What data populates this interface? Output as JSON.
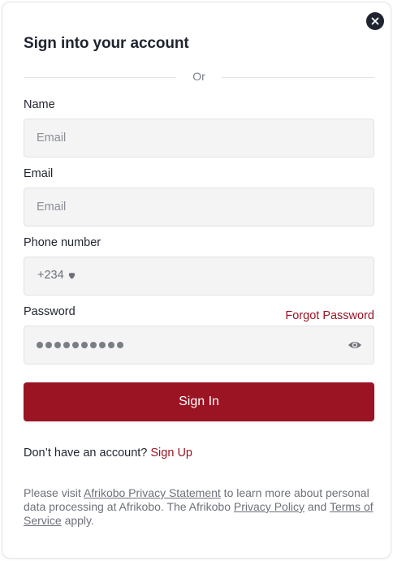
{
  "modal": {
    "title": "Sign into your account",
    "divider_text": "Or"
  },
  "form": {
    "name_label": "Name",
    "name_placeholder": "Email",
    "email_label": "Email",
    "email_placeholder": "Email",
    "phone_label": "Phone number",
    "phone_prefix": "+234",
    "password_label": "Password",
    "password_dots": "●●●●●●●●●●",
    "forgot_password": "Forgot Password",
    "submit_label": "Sign In"
  },
  "signup": {
    "prompt": "Don’t have an account?",
    "link": "Sign Up"
  },
  "legal": {
    "part1": "Please visit ",
    "privacy_statement": "Afrikobo Privacy Statement",
    "part2": " to learn more about personal data processing at Afrikobo. The Afrikobo ",
    "privacy_policy": "Privacy Policy",
    "part3": " and ",
    "terms": "Terms of Service",
    "part4": " apply."
  },
  "icons": {
    "close": "close-icon",
    "dropdown": "chevron-down-icon",
    "visibility": "eye-icon"
  },
  "colors": {
    "brand": "#9b1424",
    "text": "#1f2430",
    "field_bg": "#f4f4f5"
  }
}
